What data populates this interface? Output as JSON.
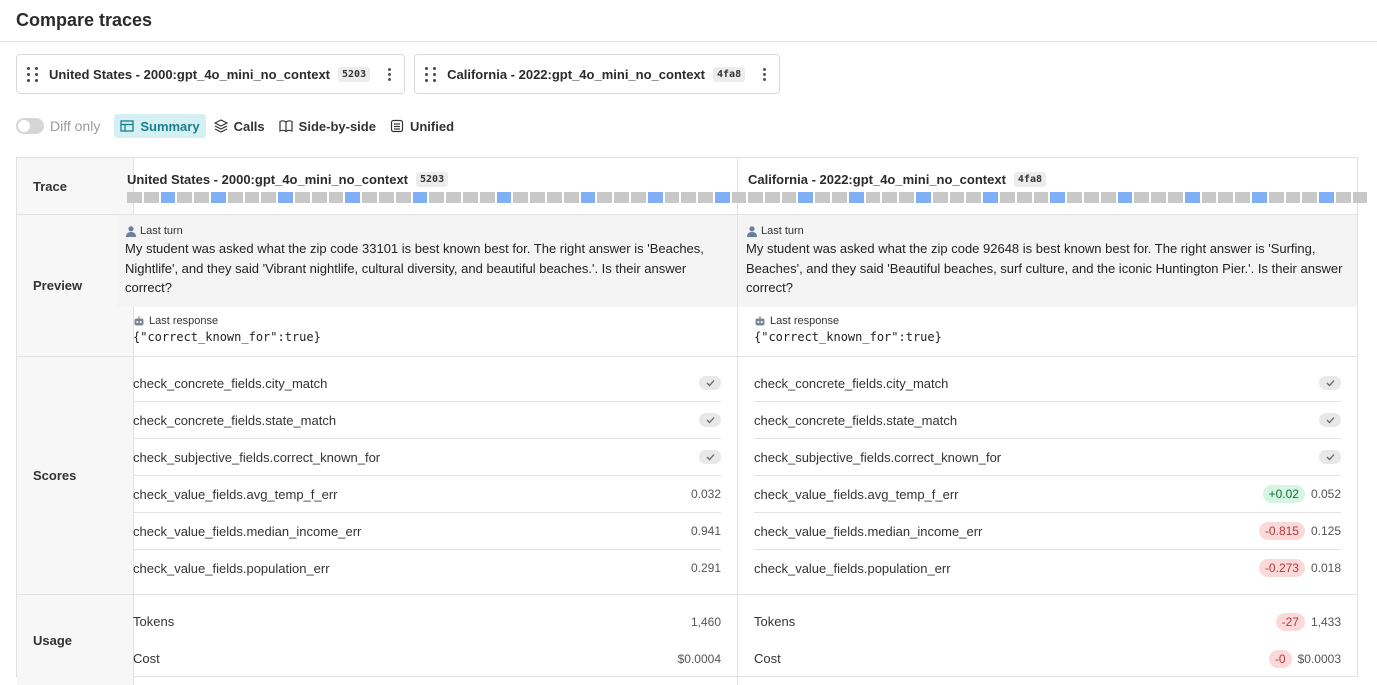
{
  "page": {
    "title": "Compare traces"
  },
  "traces": [
    {
      "name": "United States - 2000:gpt_4o_mini_no_context",
      "hash": "5203"
    },
    {
      "name": "California - 2022:gpt_4o_mini_no_context",
      "hash": "4fa8"
    }
  ],
  "toolbar": {
    "diff_only_label": "Diff only",
    "diff_only_on": false,
    "views": [
      {
        "label": "Summary",
        "active": true,
        "icon": "table-icon"
      },
      {
        "label": "Calls",
        "active": false,
        "icon": "layers-icon"
      },
      {
        "label": "Side-by-side",
        "active": false,
        "icon": "book-open-icon"
      },
      {
        "label": "Unified",
        "active": false,
        "icon": "document-icon"
      }
    ]
  },
  "row_labels": {
    "trace": "Trace",
    "preview": "Preview",
    "scores": "Scores",
    "usage": "Usage"
  },
  "trace_calls": [
    {
      "highlighted": [
        2,
        5,
        9,
        13,
        17,
        22,
        27,
        31,
        35
      ]
    },
    {
      "highlighted": [
        3,
        6,
        10,
        14,
        18,
        22,
        26,
        30,
        34
      ]
    }
  ],
  "preview": {
    "last_turn_label": "Last turn",
    "last_response_label": "Last response",
    "a": {
      "turn": "My student was asked what the zip code 33101 is best known best for. The right answer is 'Beaches, Nightlife', and they said 'Vibrant nightlife, cultural diversity, and beautiful beaches.'. Is their answer correct?",
      "response": "{\"correct_known_for\":true}"
    },
    "b": {
      "turn": "My student was asked what the zip code 92648 is best known best for. The right answer is 'Surfing, Beaches', and they said 'Beautiful beaches, surf culture, and the iconic Huntington Pier.'. Is their answer correct?",
      "response": "{\"correct_known_for\":true}"
    }
  },
  "scores": {
    "names": [
      "check_concrete_fields.city_match",
      "check_concrete_fields.state_match",
      "check_subjective_fields.correct_known_for",
      "check_value_fields.avg_temp_f_err",
      "check_value_fields.median_income_err",
      "check_value_fields.population_err"
    ],
    "a": {
      "values": [
        "",
        "",
        "",
        "0.032",
        "0.941",
        "0.291"
      ]
    },
    "b": {
      "values": [
        "",
        "",
        "",
        "0.052",
        "0.125",
        "0.018"
      ],
      "deltas": [
        "",
        "",
        "",
        "+0.02",
        "-0.815",
        "-0.273"
      ]
    }
  },
  "usage": {
    "names": [
      "Tokens",
      "Cost"
    ],
    "a": {
      "values": [
        "1,460",
        "$0.0004"
      ]
    },
    "b": {
      "values": [
        "1,433",
        "$0.0003"
      ],
      "deltas": [
        "-27",
        "-0"
      ]
    }
  },
  "colors": {
    "accent": "#1b7f8c",
    "active_bg": "#d4f0f3",
    "call_highlight": "#7fb0f5",
    "positive": "#166a36",
    "negative": "#b33a3a"
  }
}
